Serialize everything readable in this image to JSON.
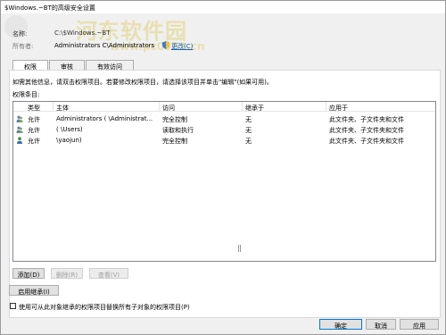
{
  "window": {
    "title": "$Windows.~BT的高级安全设置"
  },
  "watermark": {
    "text": "河东软件园",
    "url": "www.pc0359.cn"
  },
  "header": {
    "name_label": "名称:",
    "name_value": "C:\\$Windows.~BT",
    "owner_label": "所有者:",
    "owner_value": "Administrators C\\Administrators",
    "change_link": "更改(C)"
  },
  "tabs": [
    {
      "label": "权限",
      "active": true
    },
    {
      "label": "审核",
      "active": false
    },
    {
      "label": "有效访问",
      "active": false
    }
  ],
  "info_text": "如需其他信息，请双击权限项目。若要修改权限项目，请选择该项目并单击\"编辑\"(如果可用)。",
  "entries_label": "权限条目:",
  "table": {
    "columns": [
      "类型",
      "主体",
      "访问",
      "继承于",
      "应用于"
    ],
    "rows": [
      {
        "type": "允许",
        "principal": "Administrators (  \\Administrat...",
        "access": "完全控制",
        "inherited": "无",
        "applies": "此文件夹、子文件夹和文件",
        "icon": "user-group-icon"
      },
      {
        "type": "允许",
        "principal": "  (  \\Users)",
        "access": "读取和执行",
        "inherited": "无",
        "applies": "此文件夹、子文件夹和文件",
        "icon": "user-group-icon"
      },
      {
        "type": "允许",
        "principal": "  \\yaojun)",
        "access": "完全控制",
        "inherited": "无",
        "applies": "此文件夹、子文件夹和文件",
        "icon": "user-icon"
      }
    ]
  },
  "buttons": {
    "add": "添加(D)",
    "remove": "删除(R)",
    "view": "查看(V)",
    "enable_inheritance": "启用继承(I)",
    "ok": "确定",
    "cancel": "取消",
    "apply": "应用"
  },
  "checkbox": {
    "label": "使用可从此对象继承的权限项目替换所有子对象的权限项目(P)",
    "checked": false
  },
  "colors": {
    "link": "#1a5fb4",
    "accent": "#0078d7",
    "watermark": "#e8dfb2"
  }
}
